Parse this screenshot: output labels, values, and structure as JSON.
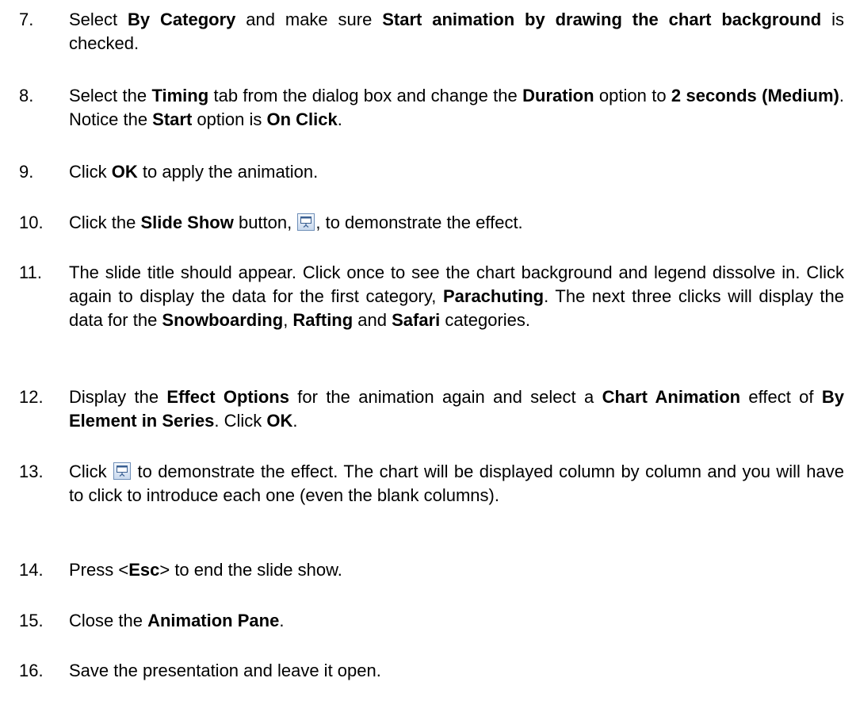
{
  "steps": [
    {
      "num": "7.",
      "parts": [
        {
          "t": "Select "
        },
        {
          "t": "By Category",
          "b": true
        },
        {
          "t": " and make sure "
        },
        {
          "t": "Start animation by drawing the chart background",
          "b": true
        },
        {
          "t": " is checked."
        }
      ]
    },
    {
      "num": "8.",
      "parts": [
        {
          "t": "Select the "
        },
        {
          "t": "Timing",
          "b": true
        },
        {
          "t": " tab from the dialog box and change the "
        },
        {
          "t": "Duration",
          "b": true
        },
        {
          "t": " option to "
        },
        {
          "t": "2 seconds (Medium)",
          "b": true
        },
        {
          "t": ". Notice the "
        },
        {
          "t": "Start",
          "b": true
        },
        {
          "t": " option is "
        },
        {
          "t": "On Click",
          "b": true
        },
        {
          "t": "."
        }
      ]
    },
    {
      "num": "9.",
      "parts": [
        {
          "t": "Click "
        },
        {
          "t": "OK",
          "b": true
        },
        {
          "t": " to apply the animation."
        }
      ]
    },
    {
      "num": "10.",
      "parts": [
        {
          "t": "Click the "
        },
        {
          "t": "Slide Show",
          "b": true
        },
        {
          "t": " button, "
        },
        {
          "icon": "slide-show-icon"
        },
        {
          "t": ", to demonstrate the effect."
        }
      ]
    },
    {
      "num": "11.",
      "parts": [
        {
          "t": "The slide title should appear. Click once to see the chart background and legend dissolve in. Click again to display the data for the first category, "
        },
        {
          "t": "Parachuting",
          "b": true
        },
        {
          "t": ". The next three clicks will display the data for the "
        },
        {
          "t": "Snowboarding",
          "b": true
        },
        {
          "t": ", "
        },
        {
          "t": "Rafting",
          "b": true
        },
        {
          "t": " and "
        },
        {
          "t": "Safari",
          "b": true
        },
        {
          "t": " categories."
        }
      ]
    },
    {
      "num": "12.",
      "parts": [
        {
          "t": "Display the "
        },
        {
          "t": "Effect Options",
          "b": true
        },
        {
          "t": " for the animation again and select a "
        },
        {
          "t": "Chart Animation",
          "b": true
        },
        {
          "t": " effect of "
        },
        {
          "t": "By Element in Series",
          "b": true
        },
        {
          "t": ". Click "
        },
        {
          "t": "OK",
          "b": true
        },
        {
          "t": "."
        }
      ]
    },
    {
      "num": "13.",
      "parts": [
        {
          "t": "Click "
        },
        {
          "icon": "slide-show-icon"
        },
        {
          "t": " to demonstrate the effect. The chart will be displayed column by column and you will have to click to introduce each one (even the blank columns)."
        }
      ]
    },
    {
      "num": "14.",
      "parts": [
        {
          "t": "Press <"
        },
        {
          "t": "Esc",
          "b": true
        },
        {
          "t": "> to end the slide show."
        }
      ]
    },
    {
      "num": "15.",
      "parts": [
        {
          "t": "Close the "
        },
        {
          "t": "Animation Pane",
          "b": true
        },
        {
          "t": "."
        }
      ]
    },
    {
      "num": "16.",
      "parts": [
        {
          "t": "Save the presentation and leave it open."
        }
      ]
    }
  ]
}
